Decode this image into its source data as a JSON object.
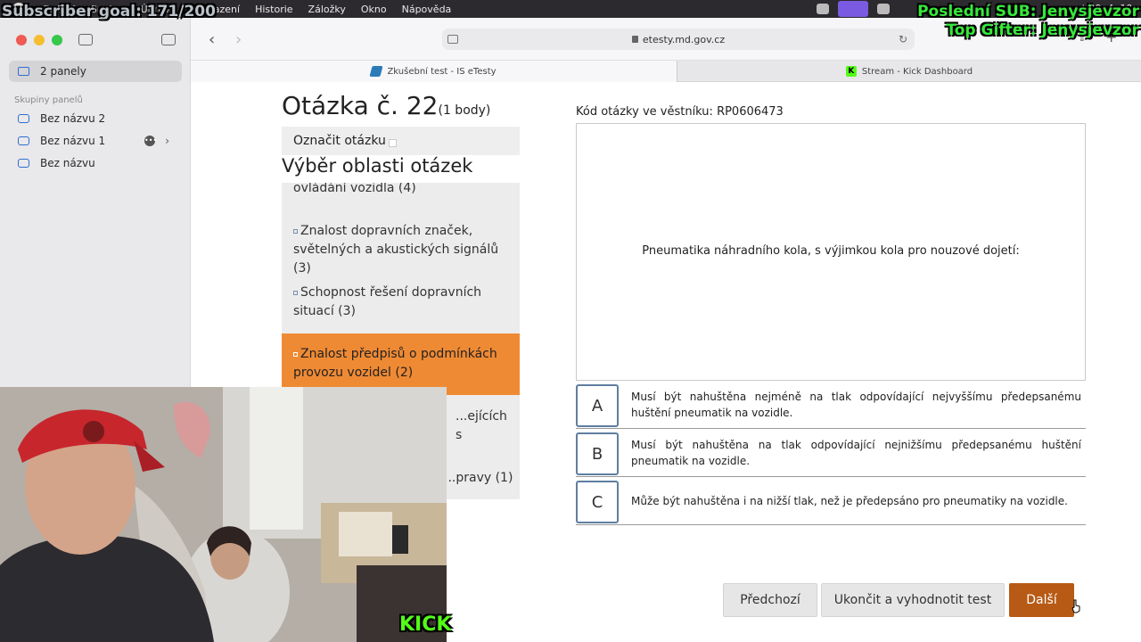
{
  "menubar": {
    "items": [
      "Safari",
      "Soubor",
      "Úpravy",
      "Zobrazení",
      "Historie",
      "Záložky",
      "Okno",
      "Nápověda"
    ],
    "clock": "st 29. 4.  19:"
  },
  "overlay": {
    "subscriber_goal": "Subscriber goal: 171/200",
    "last_sub": "Poslední SUB: Jenysjevzor",
    "top_gifter": "Top Gifter: Jenysjevzor",
    "kick_logo": "KICK"
  },
  "sidebar": {
    "current": "2 panely",
    "groups_heading": "Skupiny panelů",
    "groups": [
      "Bez názvu 2",
      "Bez názvu 1",
      "Bez názvu"
    ]
  },
  "toolbar": {
    "url": "etesty.md.gov.cz"
  },
  "tabs": [
    {
      "title": "Zkušební test - IS eTesty",
      "icon": "etesty-favicon"
    },
    {
      "title": "Stream - Kick Dashboard",
      "icon": "kick-favicon",
      "icon_letter": "K"
    }
  ],
  "question": {
    "title": "Otázka č. 22",
    "points": "(1 body)",
    "mark_label": "Označit otázku",
    "code_label": "Kód otázky ve věstníku: RP0606473",
    "text": "Pneumatika náhradního kola, s výjimkou kola pro nouzové dojetí:"
  },
  "areas": {
    "title": "Výběr oblasti otázek",
    "items": [
      {
        "label": "ovládání vozidla (4)"
      },
      {
        "label": "Znalost dopravních značek, světelných a akustických signálů (3)"
      },
      {
        "label": "Schopnost řešení dopravních situací (3)"
      },
      {
        "label": "Znalost předpisů o podmínkách provozu vozidel (2)"
      },
      {
        "label": "...ejících s"
      },
      {
        "label": "...pravy (1)"
      }
    ]
  },
  "answers": [
    {
      "letter": "A",
      "text": "Musí být nahuštěna nejméně na tlak odpovídající nejvyššímu předepsanému huštění pneumatik na vozidle."
    },
    {
      "letter": "B",
      "text": "Musí být nahuštěna na tlak odpovídající nejnižšímu předepsanému huštění pneumatik na vozidle."
    },
    {
      "letter": "C",
      "text": "Může být nahuštěna i na nižší tlak, než je předepsáno pro pneumatiky na vozidle."
    }
  ],
  "buttons": {
    "prev": "Předchozí",
    "finish": "Ukončit a vyhodnotit test",
    "next": "Další"
  },
  "colors": {
    "highlight": "#ef8a34",
    "next_button": "#b75a15",
    "overlay_green": "#35e83a"
  }
}
